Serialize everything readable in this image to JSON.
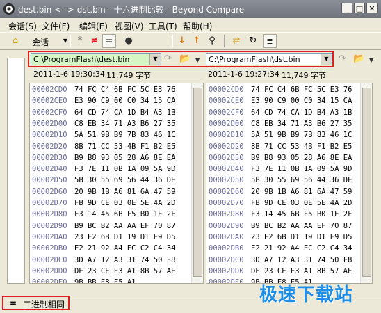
{
  "window": {
    "title": "dest.bin <--> dst.bin - 十六进制比较 - Beyond Compare",
    "watermark": "极速下载站"
  },
  "menu": [
    "会话(S)",
    "文件(F)",
    "编辑(E)",
    "视图(V)",
    "工具(T)",
    "帮助(H)"
  ],
  "toolbar": {
    "session_label": "会话",
    "icons": [
      "home-icon",
      "session-dropdown",
      "all-differences-icon",
      "not-equal-icon",
      "equal-icon",
      "rules-icon",
      "next-difference-icon",
      "prev-difference-icon",
      "find-icon",
      "swap-icon",
      "refresh-icon",
      "details-icon"
    ]
  },
  "left": {
    "path": "C:\\ProgramFlash\\dest.bin",
    "date": "2011-1-6 19:30:34",
    "size": "11,749 字节"
  },
  "right": {
    "path": "C:\\ProgramFlash\\dst.bin",
    "date": "2011-1-6 19:27:34",
    "size": "11,749 字节"
  },
  "hex_rows": [
    {
      "addr": "00002CD0",
      "bytes": "74 FC C4 6B FC 5C E3 76"
    },
    {
      "addr": "00002CE0",
      "bytes": "E3 90 C9 00 C0 34 15 CA"
    },
    {
      "addr": "00002CF0",
      "bytes": "64 CD 74 CA 1D B4 A3 1B"
    },
    {
      "addr": "00002D00",
      "bytes": "C8 EB 34 71 A3 B6 27 35"
    },
    {
      "addr": "00002D10",
      "bytes": "5A 51 9B B9 7B 83 46 1C"
    },
    {
      "addr": "00002D20",
      "bytes": "8B 71 CC 53 4B F1 B2 E5"
    },
    {
      "addr": "00002D30",
      "bytes": "B9 B8 93 05 28 A6 8E EA"
    },
    {
      "addr": "00002D40",
      "bytes": "F3 7E 11 0B 1A 09 5A 9D"
    },
    {
      "addr": "00002D50",
      "bytes": "5B 30 55 69 56 44 36 DE"
    },
    {
      "addr": "00002D60",
      "bytes": "20 9B 1B A6 81 6A 47 59"
    },
    {
      "addr": "00002D70",
      "bytes": "FB 9D CE 03 0E 5E 4A 2D"
    },
    {
      "addr": "00002D80",
      "bytes": "F3 14 45 6B F5 B0 1E 2F"
    },
    {
      "addr": "00002D90",
      "bytes": "B9 BC B2 AA AA EF 70 87"
    },
    {
      "addr": "00002DA0",
      "bytes": "23 E2 6B D1 19 D1 E9 D5"
    },
    {
      "addr": "00002DB0",
      "bytes": "E2 21 92 A4 EC C2 C4 34"
    },
    {
      "addr": "00002DC0",
      "bytes": "3D A7 12 A3 31 74 50 F8"
    },
    {
      "addr": "00002DD0",
      "bytes": "DE 23 CE E3 A1 8B 57 AE"
    },
    {
      "addr": "00002DE0",
      "bytes": "9B BB E8 E5 A1"
    }
  ],
  "status": {
    "icon": "=",
    "text": "二进制相同"
  },
  "colors": {
    "highlight_frame": "#e02020",
    "watermark": "#1e8fe8",
    "left_path_bg": "#d6f5c4",
    "right_path_bg": "#ffffff",
    "address_text": "#6a6a9a"
  }
}
